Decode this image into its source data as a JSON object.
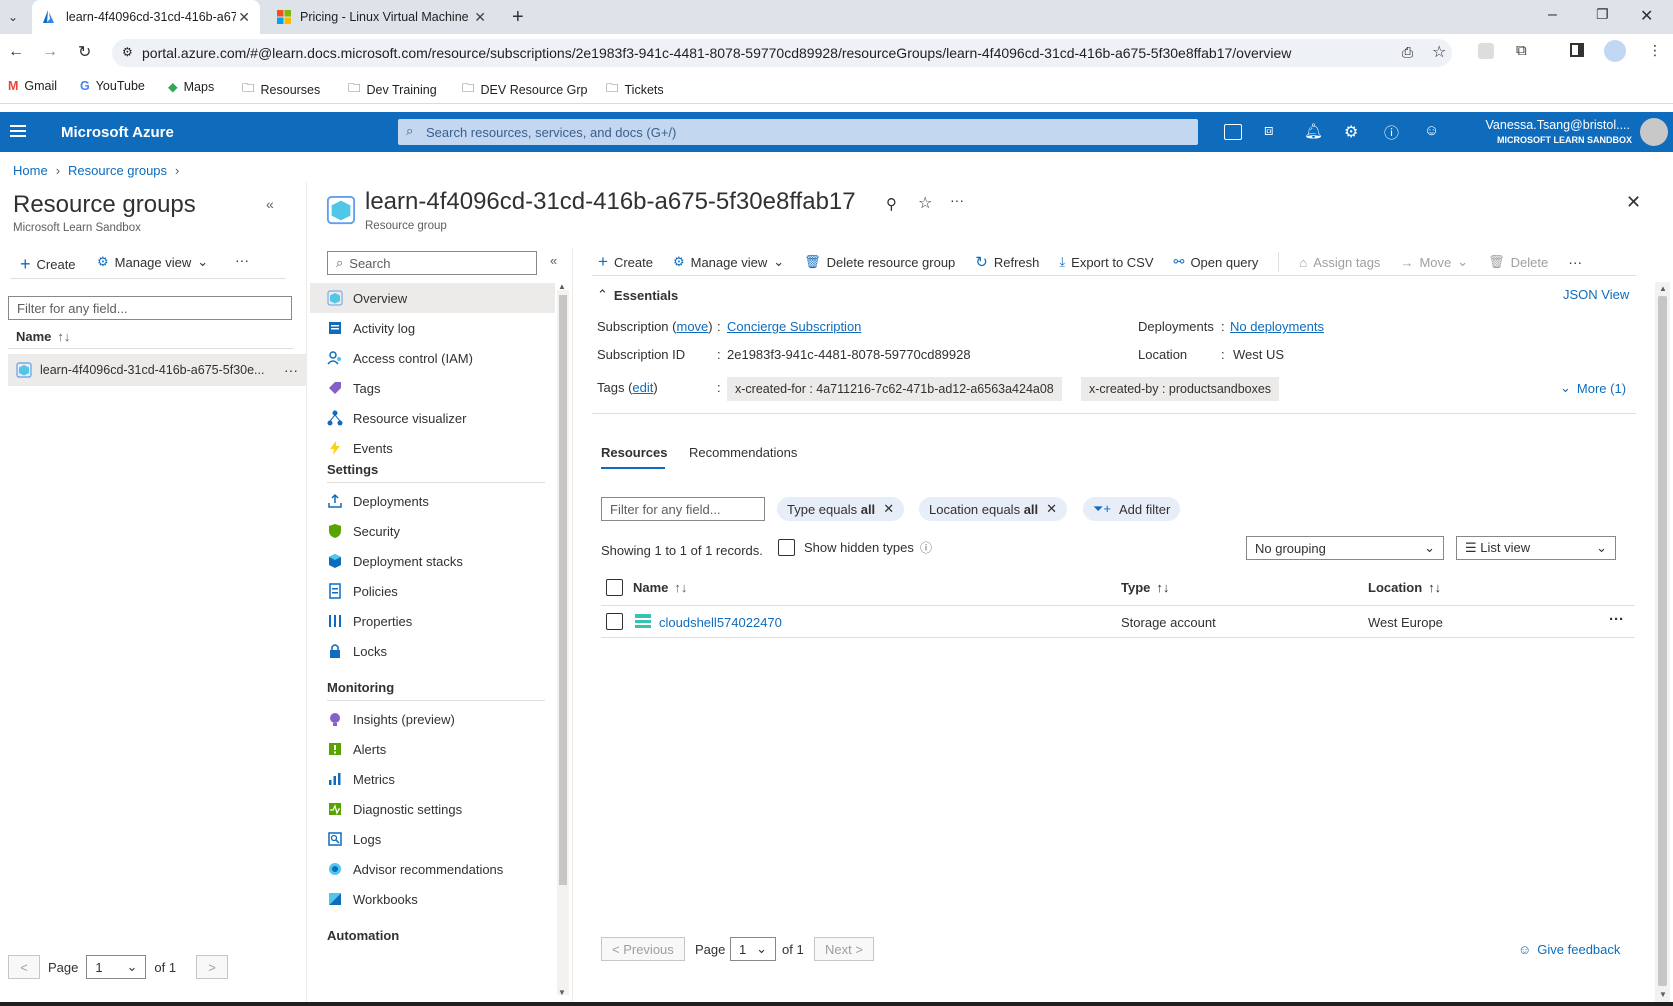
{
  "browser": {
    "tabs": [
      {
        "title": "learn-4f4096cd-31cd-416b-a67",
        "active": true
      },
      {
        "title": "Pricing - Linux Virtual Machine",
        "active": false
      }
    ],
    "url": "portal.azure.com/#@learn.docs.microsoft.com/resource/subscriptions/2e1983f3-941c-4481-8078-59770cd89928/resourceGroups/learn-4f4096cd-31cd-416b-a675-5f30e8ffab17/overview",
    "bookmarks": [
      "Gmail",
      "YouTube",
      "Maps",
      "Resourses",
      "Dev Training",
      "DEV Resource Grp",
      "Tickets"
    ]
  },
  "azure": {
    "brand": "Microsoft Azure",
    "search_placeholder": "Search resources, services, and docs (G+/)",
    "user_name": "Vanessa.Tsang@bristol....",
    "user_tenant": "MICROSOFT LEARN SANDBOX"
  },
  "breadcrumb": [
    "Home",
    "Resource groups"
  ],
  "left_panel": {
    "title": "Resource groups",
    "subtitle": "Microsoft Learn Sandbox",
    "create": "Create",
    "manage_view": "Manage view",
    "filter_placeholder": "Filter for any field...",
    "col_name": "Name",
    "item": "learn-4f4096cd-31cd-416b-a675-5f30e...",
    "page_label": "Page",
    "page_value": "1",
    "page_of": "of 1"
  },
  "resource": {
    "title": "learn-4f4096cd-31cd-416b-a675-5f30e8ffab17",
    "subtitle": "Resource group"
  },
  "nav": {
    "search_placeholder": "Search",
    "items_top": [
      "Overview",
      "Activity log",
      "Access control (IAM)",
      "Tags",
      "Resource visualizer",
      "Events"
    ],
    "settings_title": "Settings",
    "items_settings": [
      "Deployments",
      "Security",
      "Deployment stacks",
      "Policies",
      "Properties",
      "Locks"
    ],
    "monitoring_title": "Monitoring",
    "items_monitoring": [
      "Insights (preview)",
      "Alerts",
      "Metrics",
      "Diagnostic settings",
      "Logs",
      "Advisor recommendations",
      "Workbooks"
    ],
    "automation_title": "Automation"
  },
  "commands": [
    "Create",
    "Manage view",
    "Delete resource group",
    "Refresh",
    "Export to CSV",
    "Open query",
    "Assign tags",
    "Move",
    "Delete"
  ],
  "essentials": {
    "title": "Essentials",
    "json_view": "JSON View",
    "subscription_label": "Subscription",
    "move_link": "move",
    "subscription_value": "Concierge Subscription",
    "subscription_id_label": "Subscription ID",
    "subscription_id_value": "2e1983f3-941c-4481-8078-59770cd89928",
    "tags_label": "Tags",
    "edit_link": "edit",
    "tag1": "x-created-for : 4a711216-7c62-471b-ad12-a6563a424a08",
    "tag2": "x-created-by : productsandboxes",
    "deployments_label": "Deployments",
    "deployments_value": "No deployments",
    "location_label": "Location",
    "location_value": "West US",
    "more": "More (1)"
  },
  "tabs": [
    "Resources",
    "Recommendations"
  ],
  "filters": {
    "placeholder": "Filter for any field...",
    "type_pill_prefix": "Type equals ",
    "type_pill_value": "all",
    "loc_pill_prefix": "Location equals ",
    "loc_pill_value": "all",
    "add_filter": "Add filter",
    "showing": "Showing 1 to 1 of 1 records.",
    "show_hidden": "Show hidden types",
    "grouping": "No grouping",
    "view": "List view"
  },
  "table": {
    "columns": [
      "Name",
      "Type",
      "Location"
    ],
    "rows": [
      {
        "name": "cloudshell574022470",
        "type": "Storage account",
        "location": "West Europe"
      }
    ]
  },
  "pagination": {
    "previous": "< Previous",
    "page_label": "Page",
    "page_value": "1",
    "of": "of 1",
    "next": "Next >",
    "feedback": "Give feedback"
  },
  "colors": {
    "azure_blue": "#0f6cbd",
    "header_bg": "#0f6cbd",
    "tab_bg": "#dee3ea"
  }
}
